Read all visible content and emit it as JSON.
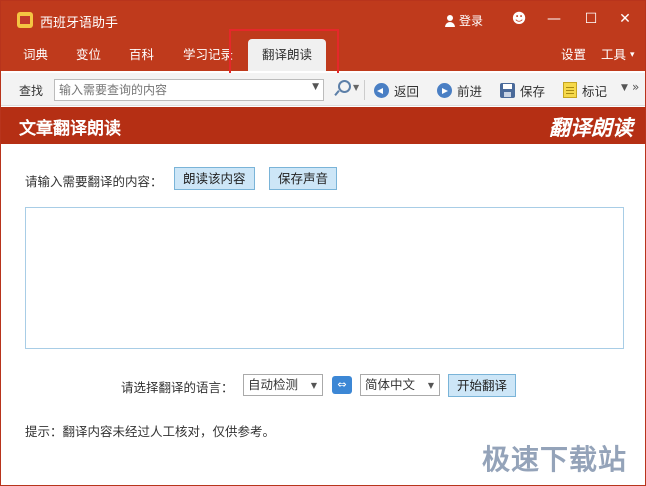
{
  "app": {
    "title": "西班牙语助手",
    "login_label": "登录"
  },
  "window_buttons": {
    "emoji": "☻",
    "minimize": "—",
    "maximize": "☐",
    "close": "✕"
  },
  "tabs": [
    {
      "label": "词典"
    },
    {
      "label": "变位"
    },
    {
      "label": "百科"
    },
    {
      "label": "学习记录"
    },
    {
      "label": "翻译朗读",
      "active": true
    }
  ],
  "tab_right": {
    "settings": "设置",
    "tools": "工具",
    "tools_caret": "▾"
  },
  "toolbar": {
    "search_label": "查找",
    "search_placeholder": "输入需要查询的内容",
    "back_label": "返回",
    "forward_label": "前进",
    "save_label": "保存",
    "mark_label": "标记",
    "more": "»"
  },
  "banner": {
    "title": "文章翻译朗读",
    "logo": "翻译朗读"
  },
  "content": {
    "prompt": "请输入需要翻译的内容：",
    "read_button": "朗读该内容",
    "save_audio_button": "保存声音",
    "lang_prompt": "请选择翻译的语言：",
    "source_lang": "自动检测",
    "swap_icon": "⇔",
    "target_lang": "简体中文",
    "translate_button": "开始翻译",
    "tip": "提示：翻译内容未经过人工核对，仅供参考。"
  },
  "watermark": "极速下载站",
  "colors": {
    "titlebar": "#bf3a1c",
    "banner": "#b52f14",
    "button_bg": "#cde6f7",
    "highlight": "#e5282a"
  }
}
